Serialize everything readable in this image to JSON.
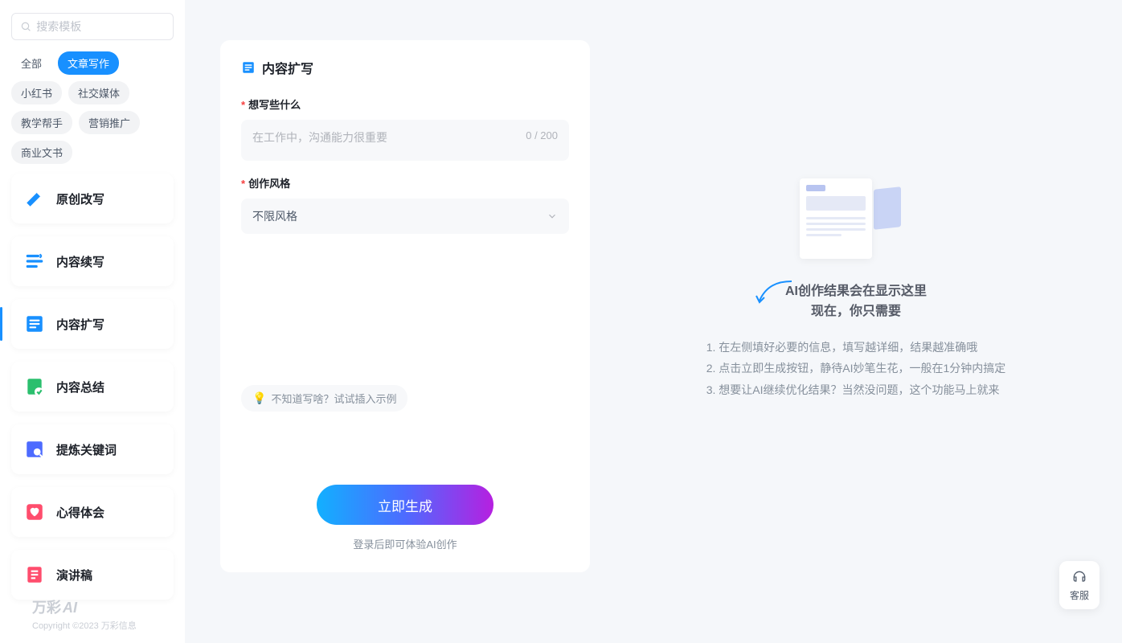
{
  "sidebar": {
    "search_placeholder": "搜索模板",
    "tags": [
      "全部",
      "文章写作",
      "小红书",
      "社交媒体",
      "教学帮手",
      "营销推广",
      "商业文书"
    ],
    "active_tag_index": 1,
    "templates": [
      {
        "label": "原创改写",
        "color": "#1890ff",
        "icon": "pencil"
      },
      {
        "label": "内容续写",
        "color": "#1890ff",
        "icon": "continue"
      },
      {
        "label": "内容扩写",
        "color": "#1890ff",
        "icon": "expand"
      },
      {
        "label": "内容总结",
        "color": "#2bbf6e",
        "icon": "summary"
      },
      {
        "label": "提炼关键词",
        "color": "#4d6bff",
        "icon": "keywords"
      },
      {
        "label": "心得体会",
        "color": "#ff4d6d",
        "icon": "heart"
      },
      {
        "label": "演讲稿",
        "color": "#ff4d6d",
        "icon": "speech"
      }
    ],
    "active_template_index": 2
  },
  "form": {
    "title": "内容扩写",
    "field1_label": "想写些什么",
    "field1_placeholder": "在工作中，沟通能力很重要",
    "field1_count": "0 / 200",
    "field2_label": "创作风格",
    "field2_value": "不限风格",
    "hint_text": "不知道写啥？试试插入示例",
    "generate_label": "立即生成",
    "login_hint": "登录后即可体验AI创作"
  },
  "result": {
    "title_line1": "AI创作结果会在显示这里",
    "title_line2": "现在，你只需要",
    "step1": "1. 在左侧填好必要的信息，填写越详细，结果越准确哦",
    "step2": "2. 点击立即生成按钮，静待AI妙笔生花，一般在1分钟内搞定",
    "step3": "3. 想要让AI继续优化结果？当然没问题，这个功能马上就来"
  },
  "footer": {
    "brand": "万彩",
    "brand_suffix": "AI",
    "copyright": "Copyright ©2023 万彩信息"
  },
  "cs": {
    "label": "客服"
  }
}
